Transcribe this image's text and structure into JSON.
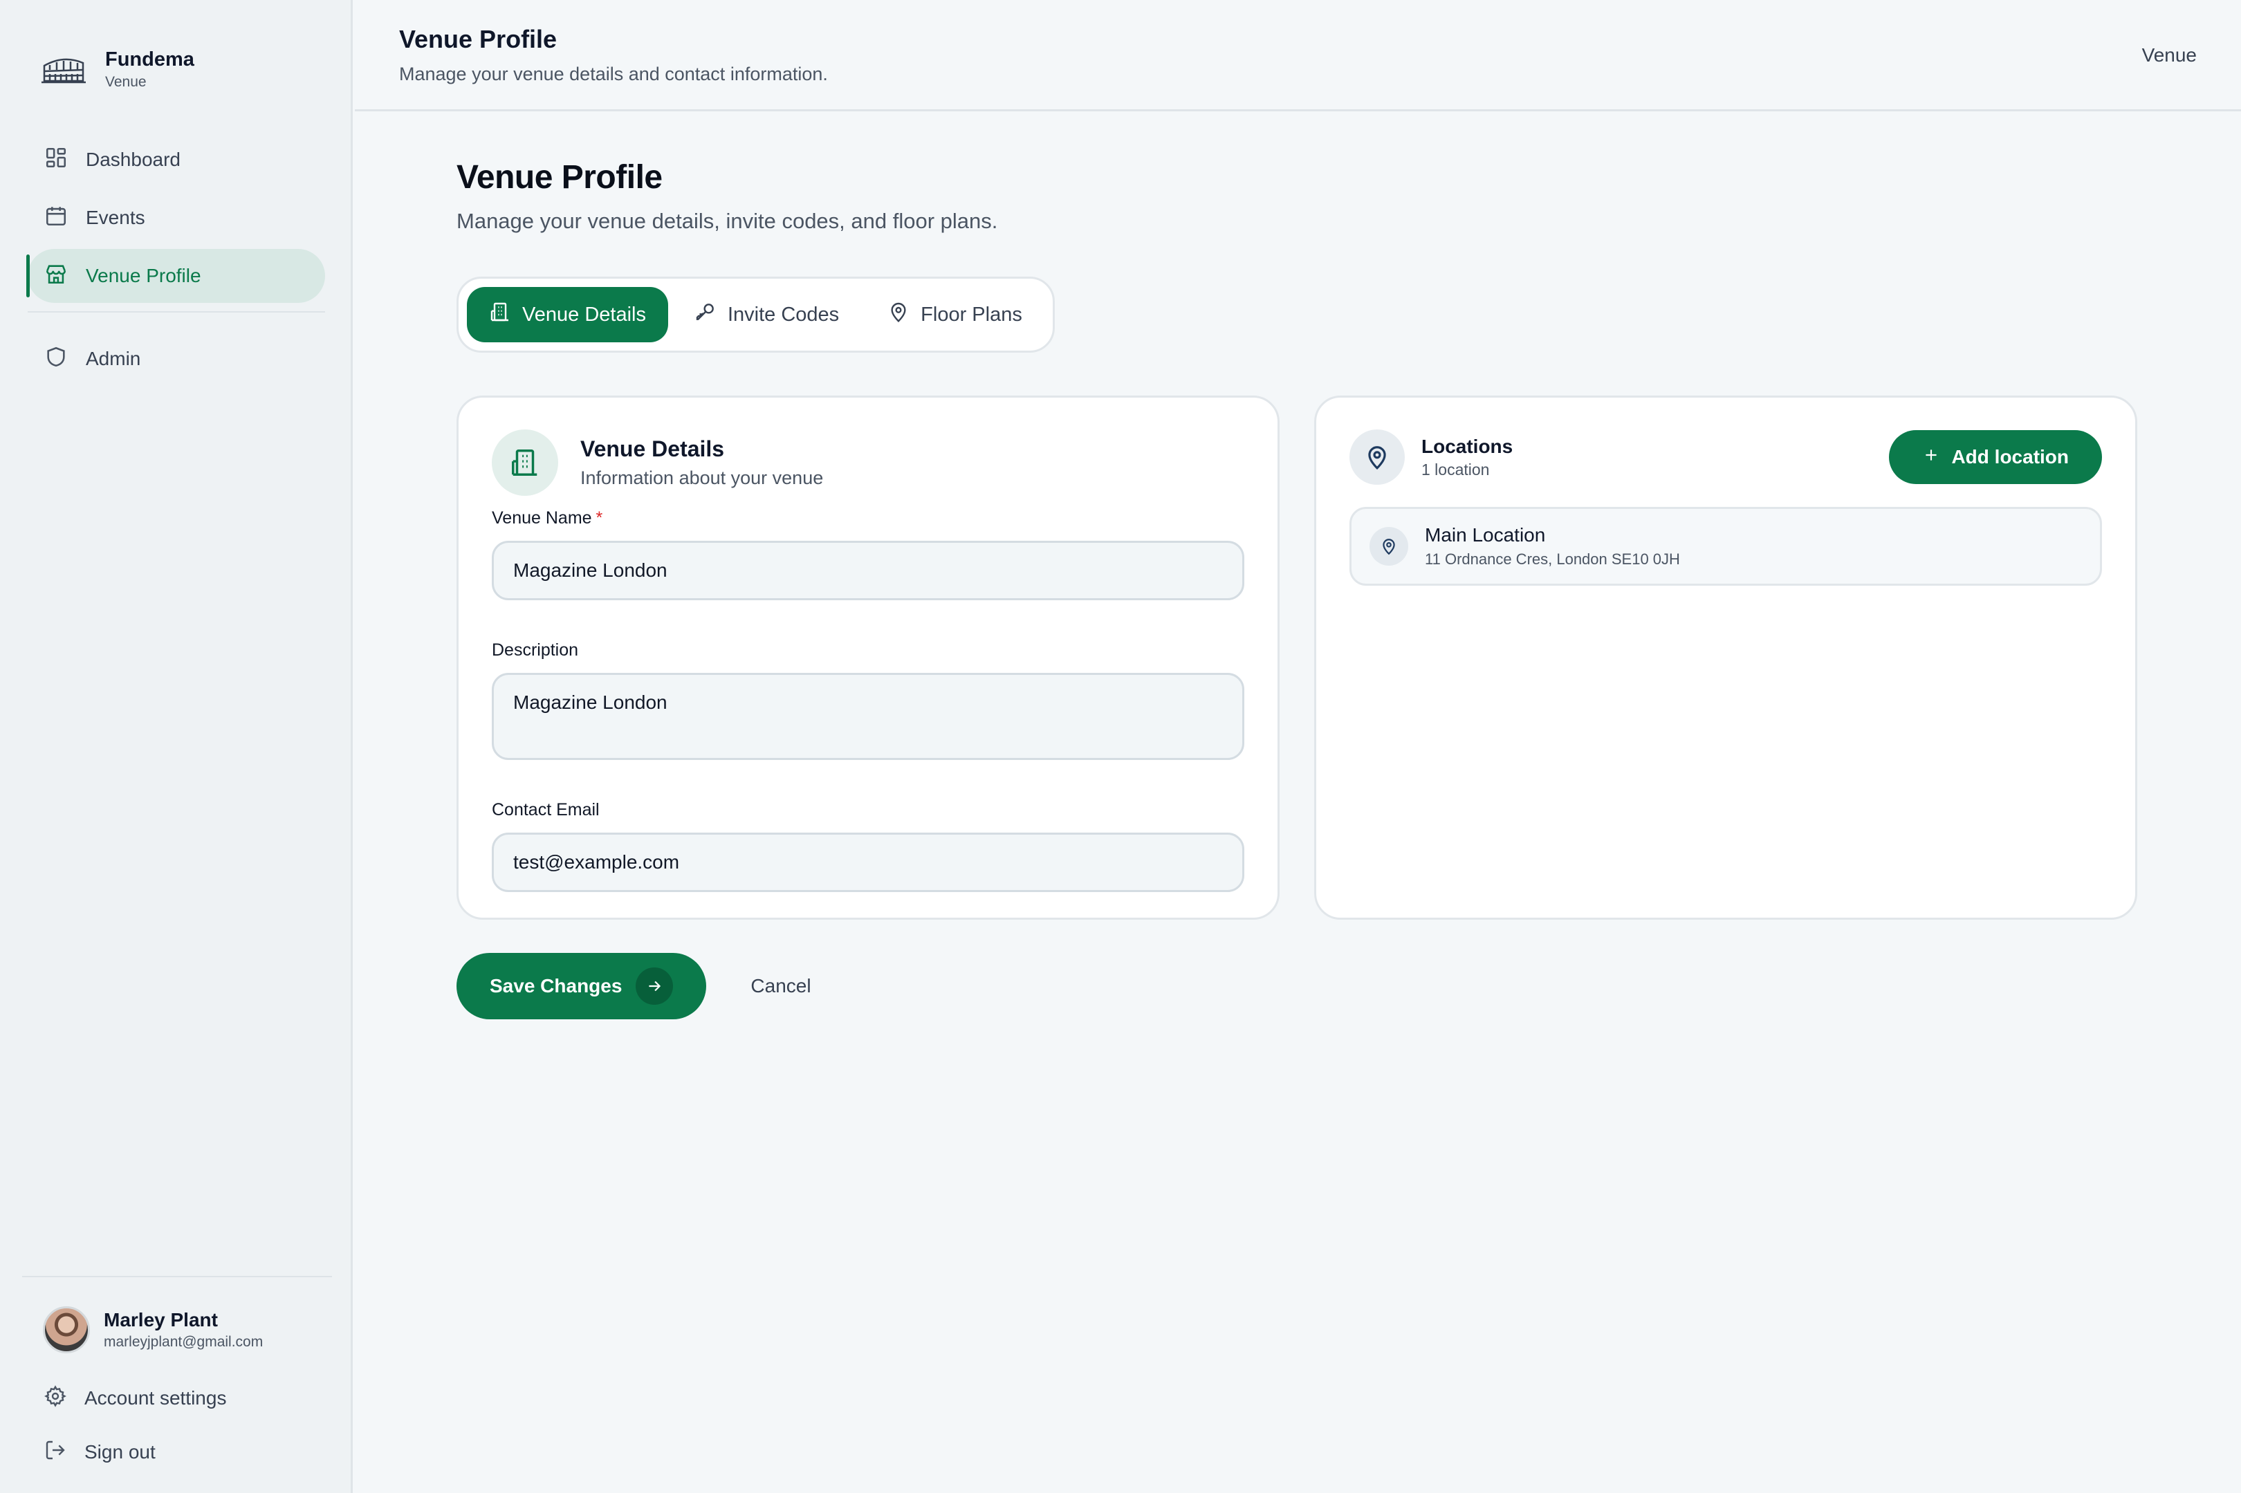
{
  "brand": {
    "name": "Fundema",
    "role": "Venue",
    "logo_icon": "colosseum-icon"
  },
  "sidebar": {
    "items": [
      {
        "label": "Dashboard",
        "icon": "dashboard-icon"
      },
      {
        "label": "Events",
        "icon": "calendar-icon"
      },
      {
        "label": "Venue Profile",
        "icon": "store-icon",
        "active": true
      },
      {
        "label": "Admin",
        "icon": "shield-icon"
      }
    ],
    "user": {
      "name": "Marley Plant",
      "email": "marleyjplant@gmail.com"
    },
    "account_settings": "Account settings",
    "sign_out": "Sign out"
  },
  "header": {
    "title": "Venue Profile",
    "subtitle": "Manage your venue details and contact information.",
    "right_label": "Venue"
  },
  "page": {
    "title": "Venue Profile",
    "subtitle": "Manage your venue details, invite codes, and floor plans."
  },
  "tabs": [
    {
      "label": "Venue Details",
      "icon": "building-icon",
      "active": true
    },
    {
      "label": "Invite Codes",
      "icon": "key-icon"
    },
    {
      "label": "Floor Plans",
      "icon": "map-pin-icon"
    }
  ],
  "details_card": {
    "title": "Venue Details",
    "subtitle": "Information about your venue",
    "venue_name": {
      "label": "Venue Name",
      "required_mark": "*",
      "value": "Magazine London"
    },
    "description": {
      "label": "Description",
      "value": "Magazine London"
    },
    "contact_email": {
      "label": "Contact Email",
      "value": "test@example.com"
    }
  },
  "locations_card": {
    "title": "Locations",
    "count": "1 location",
    "add_button": "Add location",
    "items": [
      {
        "name": "Main Location",
        "address": "11 Ordnance Cres, London SE10 0JH"
      }
    ]
  },
  "actions": {
    "save": "Save Changes",
    "cancel": "Cancel"
  },
  "colors": {
    "accent": "#0b7a4b",
    "sidebar_bg": "#eef2f4",
    "page_bg": "#f4f7f9",
    "required": "#dc2626"
  }
}
